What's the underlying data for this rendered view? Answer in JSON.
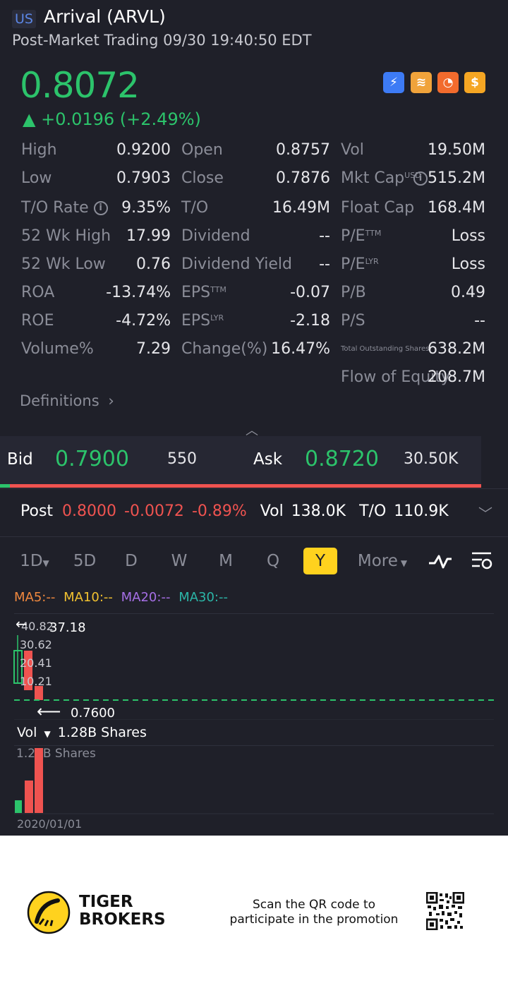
{
  "header": {
    "market": "US",
    "title": "Arrival (ARVL)",
    "subtitle": "Post-Market Trading 09/30 19:40:50 EDT"
  },
  "quote": {
    "price": "0.8072",
    "change": "▲ +0.0196 (+2.49%)",
    "badges": [
      {
        "icon": "lightning-level-1-icon",
        "color": "#3d7bf5"
      },
      {
        "icon": "stack-a-icon",
        "color": "#f0a33b"
      },
      {
        "icon": "speed-icon",
        "color": "#f26b2d"
      },
      {
        "icon": "dollar-icon",
        "color": "#f5a623"
      }
    ]
  },
  "stats": {
    "col1": [
      {
        "label": "High",
        "value": "0.9200"
      },
      {
        "label": "Low",
        "value": "0.7903"
      },
      {
        "label": "T/O Rate",
        "value": "9.35%"
      },
      {
        "label": "52 Wk High",
        "value": "17.99"
      },
      {
        "label": "52 Wk Low",
        "value": "0.76"
      },
      {
        "label": "ROA",
        "value": "-13.74%"
      },
      {
        "label": "ROE",
        "value": "-4.72%"
      },
      {
        "label": "Volume%",
        "value": "7.29"
      }
    ],
    "col2": [
      {
        "label": "Open",
        "value": "0.8757"
      },
      {
        "label": "Close",
        "value": "0.7876"
      },
      {
        "label": "T/O",
        "value": "16.49M"
      },
      {
        "label": "Dividend",
        "value": "--"
      },
      {
        "label": "Dividend Yield",
        "value": "--"
      },
      {
        "label": "EPS",
        "sup": "TTM",
        "value": "-0.07"
      },
      {
        "label": "EPS",
        "sup": "LYR",
        "value": "-2.18"
      },
      {
        "label": "Change(%)",
        "value": "16.47%"
      }
    ],
    "col3": [
      {
        "label": "Vol",
        "value": "19.50M"
      },
      {
        "label": "Mkt Cap",
        "sup": "USD",
        "value": "515.2M"
      },
      {
        "label": "Float Cap",
        "value": "168.4M"
      },
      {
        "label": "P/E",
        "sup": "TTM",
        "value": "Loss"
      },
      {
        "label": "P/E",
        "sup": "LYR",
        "value": "Loss"
      },
      {
        "label": "P/B",
        "value": "0.49"
      },
      {
        "label": "P/S",
        "value": "--"
      },
      {
        "label": "Total Outstanding Shares",
        "value": "638.2M"
      },
      {
        "label": "Flow of Equity",
        "value": "208.7M"
      }
    ],
    "definitions": "Definitions"
  },
  "bidask": {
    "bid_label": "Bid",
    "bid_price": "0.7900",
    "bid_size": "550",
    "ask_label": "Ask",
    "ask_price": "0.8720",
    "ask_size": "30.50K",
    "bid_ratio": 0.02
  },
  "post": {
    "label": "Post",
    "price": "0.8000",
    "change": "-0.0072",
    "pct": "-0.89%",
    "vol_label": "Vol",
    "vol": "138.0K",
    "to_label": "T/O",
    "to": "110.9K"
  },
  "timeframes": {
    "tabs": [
      "1D",
      "5D",
      "D",
      "W",
      "M",
      "Q",
      "Y"
    ],
    "active": "Y",
    "more": "More"
  },
  "ma": {
    "ma5": "MA5:--",
    "ma10": "MA10:--",
    "ma20": "MA20:--",
    "ma30": "MA30:--",
    "colors": {
      "ma5": "#f0883e",
      "ma10": "#f2c230",
      "ma20": "#a66fe6",
      "ma30": "#2bb5a7"
    }
  },
  "chart": {
    "y_ticks": [
      "40.82",
      "30.62",
      "20.41",
      "10.21"
    ],
    "high_marker": "37.18",
    "low_marker": "0.7600",
    "vol_label": "Vol",
    "vol_value": "1.28B Shares",
    "vol_axis": "1.28B Shares",
    "date_label": "2020/01/01"
  },
  "footer": {
    "brand_line1": "TIGER",
    "brand_line2": "BROKERS",
    "promo_line1": "Scan the QR code to",
    "promo_line2": "participate in the promotion"
  }
}
